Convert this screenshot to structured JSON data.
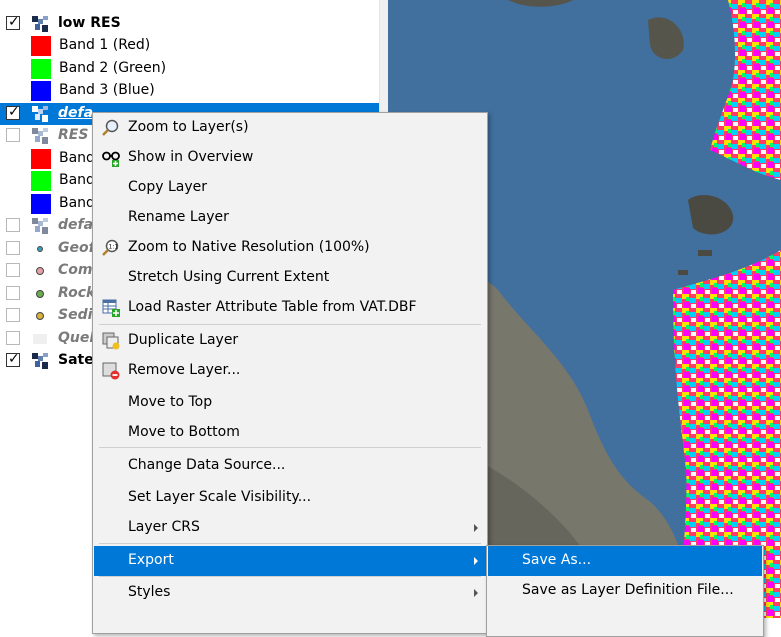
{
  "layers": [
    {
      "name": "low RES",
      "checked": true,
      "style": "bold"
    },
    {
      "band": "Band 1 (Red)",
      "color": "#ff0000"
    },
    {
      "band": "Band 2 (Green)",
      "color": "#00ff00"
    },
    {
      "band": "Band 3 (Blue)",
      "color": "#0000ff"
    },
    {
      "name": "defa",
      "checked": true,
      "style": "selected"
    },
    {
      "name": "RES",
      "checked": false,
      "style": "italic"
    },
    {
      "band": "Band",
      "color": "#ff0000"
    },
    {
      "band": "Band",
      "color": "#00ff00"
    },
    {
      "band": "Band",
      "color": "#0000ff"
    },
    {
      "name": "defa",
      "checked": false,
      "style": "italic"
    },
    {
      "name": "Geof",
      "checked": false,
      "style": "italic",
      "dot": "#3aa0b8"
    },
    {
      "name": "Comp",
      "checked": false,
      "style": "italic",
      "dot": "#e8a0a8"
    },
    {
      "name": "Rock",
      "checked": false,
      "style": "italic",
      "dot": "#6aaa50"
    },
    {
      "name": "Sedin",
      "checked": false,
      "style": "italic",
      "dot": "#d8b040"
    },
    {
      "name": "Queb",
      "checked": false,
      "style": "italic"
    },
    {
      "name": "Satel",
      "checked": true,
      "style": "bold"
    }
  ],
  "context_menu": {
    "items": [
      {
        "label": "Zoom to Layer(s)",
        "icon": "zoom-layer-icon"
      },
      {
        "label": "Show in Overview",
        "icon": "overview-icon"
      },
      {
        "label": "Copy Layer"
      },
      {
        "label": "Rename Layer"
      },
      {
        "label": "Zoom to Native Resolution (100%)",
        "icon": "zoom-native-icon"
      },
      {
        "label": "Stretch Using Current Extent"
      },
      {
        "label": "Load Raster Attribute Table from VAT.DBF",
        "icon": "attribute-table-icon"
      },
      {
        "label": "Duplicate Layer",
        "icon": "duplicate-icon"
      },
      {
        "label": "Remove Layer...",
        "icon": "remove-icon"
      },
      {
        "label": "Move to Top"
      },
      {
        "label": "Move to Bottom"
      },
      {
        "label": "Change Data Source..."
      },
      {
        "label": "Set Layer Scale Visibility..."
      },
      {
        "label": "Layer CRS",
        "submenu": true
      },
      {
        "label": "Export",
        "submenu": true,
        "active": true
      },
      {
        "label": "Styles",
        "submenu": true
      }
    ]
  },
  "export_submenu": {
    "items": [
      {
        "label": "Save As...",
        "active": true
      },
      {
        "label": "Save as Layer Definition File..."
      }
    ]
  },
  "colors": {
    "selection": "#0078d7",
    "menu_bg": "#f2f2f2",
    "water": "#3f6f9f"
  }
}
